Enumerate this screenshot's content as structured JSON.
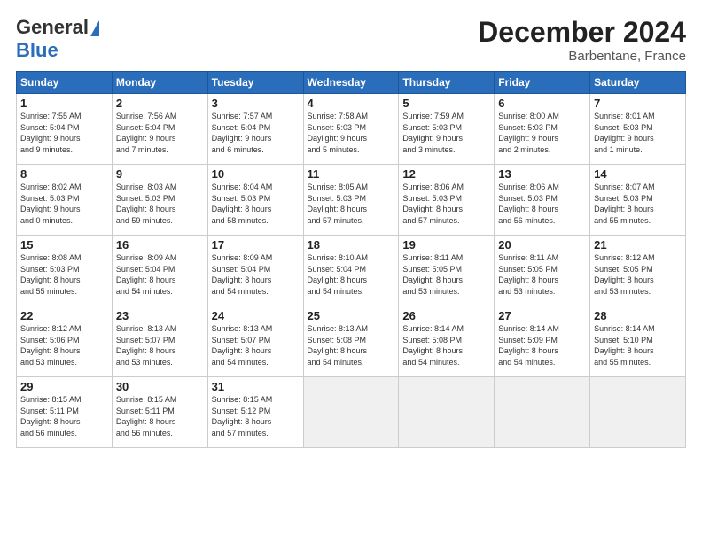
{
  "header": {
    "logo_general": "General",
    "logo_blue": "Blue",
    "month_title": "December 2024",
    "location": "Barbentane, France"
  },
  "weekdays": [
    "Sunday",
    "Monday",
    "Tuesday",
    "Wednesday",
    "Thursday",
    "Friday",
    "Saturday"
  ],
  "weeks": [
    [
      {
        "num": "1",
        "info": "Sunrise: 7:55 AM\nSunset: 5:04 PM\nDaylight: 9 hours\nand 9 minutes."
      },
      {
        "num": "2",
        "info": "Sunrise: 7:56 AM\nSunset: 5:04 PM\nDaylight: 9 hours\nand 7 minutes."
      },
      {
        "num": "3",
        "info": "Sunrise: 7:57 AM\nSunset: 5:04 PM\nDaylight: 9 hours\nand 6 minutes."
      },
      {
        "num": "4",
        "info": "Sunrise: 7:58 AM\nSunset: 5:03 PM\nDaylight: 9 hours\nand 5 minutes."
      },
      {
        "num": "5",
        "info": "Sunrise: 7:59 AM\nSunset: 5:03 PM\nDaylight: 9 hours\nand 3 minutes."
      },
      {
        "num": "6",
        "info": "Sunrise: 8:00 AM\nSunset: 5:03 PM\nDaylight: 9 hours\nand 2 minutes."
      },
      {
        "num": "7",
        "info": "Sunrise: 8:01 AM\nSunset: 5:03 PM\nDaylight: 9 hours\nand 1 minute."
      }
    ],
    [
      {
        "num": "8",
        "info": "Sunrise: 8:02 AM\nSunset: 5:03 PM\nDaylight: 9 hours\nand 0 minutes."
      },
      {
        "num": "9",
        "info": "Sunrise: 8:03 AM\nSunset: 5:03 PM\nDaylight: 8 hours\nand 59 minutes."
      },
      {
        "num": "10",
        "info": "Sunrise: 8:04 AM\nSunset: 5:03 PM\nDaylight: 8 hours\nand 58 minutes."
      },
      {
        "num": "11",
        "info": "Sunrise: 8:05 AM\nSunset: 5:03 PM\nDaylight: 8 hours\nand 57 minutes."
      },
      {
        "num": "12",
        "info": "Sunrise: 8:06 AM\nSunset: 5:03 PM\nDaylight: 8 hours\nand 57 minutes."
      },
      {
        "num": "13",
        "info": "Sunrise: 8:06 AM\nSunset: 5:03 PM\nDaylight: 8 hours\nand 56 minutes."
      },
      {
        "num": "14",
        "info": "Sunrise: 8:07 AM\nSunset: 5:03 PM\nDaylight: 8 hours\nand 55 minutes."
      }
    ],
    [
      {
        "num": "15",
        "info": "Sunrise: 8:08 AM\nSunset: 5:03 PM\nDaylight: 8 hours\nand 55 minutes."
      },
      {
        "num": "16",
        "info": "Sunrise: 8:09 AM\nSunset: 5:04 PM\nDaylight: 8 hours\nand 54 minutes."
      },
      {
        "num": "17",
        "info": "Sunrise: 8:09 AM\nSunset: 5:04 PM\nDaylight: 8 hours\nand 54 minutes."
      },
      {
        "num": "18",
        "info": "Sunrise: 8:10 AM\nSunset: 5:04 PM\nDaylight: 8 hours\nand 54 minutes."
      },
      {
        "num": "19",
        "info": "Sunrise: 8:11 AM\nSunset: 5:05 PM\nDaylight: 8 hours\nand 53 minutes."
      },
      {
        "num": "20",
        "info": "Sunrise: 8:11 AM\nSunset: 5:05 PM\nDaylight: 8 hours\nand 53 minutes."
      },
      {
        "num": "21",
        "info": "Sunrise: 8:12 AM\nSunset: 5:05 PM\nDaylight: 8 hours\nand 53 minutes."
      }
    ],
    [
      {
        "num": "22",
        "info": "Sunrise: 8:12 AM\nSunset: 5:06 PM\nDaylight: 8 hours\nand 53 minutes."
      },
      {
        "num": "23",
        "info": "Sunrise: 8:13 AM\nSunset: 5:07 PM\nDaylight: 8 hours\nand 53 minutes."
      },
      {
        "num": "24",
        "info": "Sunrise: 8:13 AM\nSunset: 5:07 PM\nDaylight: 8 hours\nand 54 minutes."
      },
      {
        "num": "25",
        "info": "Sunrise: 8:13 AM\nSunset: 5:08 PM\nDaylight: 8 hours\nand 54 minutes."
      },
      {
        "num": "26",
        "info": "Sunrise: 8:14 AM\nSunset: 5:08 PM\nDaylight: 8 hours\nand 54 minutes."
      },
      {
        "num": "27",
        "info": "Sunrise: 8:14 AM\nSunset: 5:09 PM\nDaylight: 8 hours\nand 54 minutes."
      },
      {
        "num": "28",
        "info": "Sunrise: 8:14 AM\nSunset: 5:10 PM\nDaylight: 8 hours\nand 55 minutes."
      }
    ],
    [
      {
        "num": "29",
        "info": "Sunrise: 8:15 AM\nSunset: 5:11 PM\nDaylight: 8 hours\nand 56 minutes."
      },
      {
        "num": "30",
        "info": "Sunrise: 8:15 AM\nSunset: 5:11 PM\nDaylight: 8 hours\nand 56 minutes."
      },
      {
        "num": "31",
        "info": "Sunrise: 8:15 AM\nSunset: 5:12 PM\nDaylight: 8 hours\nand 57 minutes."
      },
      null,
      null,
      null,
      null
    ]
  ]
}
